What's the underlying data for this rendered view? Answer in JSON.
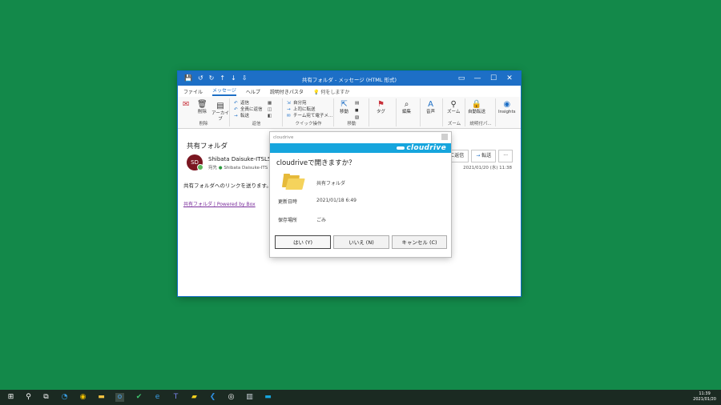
{
  "window": {
    "title": "共有フォルダ - メッセージ (HTML 形式)",
    "quick_access": [
      "💾",
      "↺",
      "↻",
      "↑",
      "↓",
      "⇩"
    ],
    "controls": [
      "▭",
      "—",
      "☐",
      "✕"
    ]
  },
  "tabs": {
    "items": [
      "ファイル",
      "メッセージ",
      "ヘルプ",
      "説明付きパスタ"
    ],
    "tell_me": "何をしますか"
  },
  "ribbon": {
    "delete": {
      "label": "削除",
      "archive": "アーカイブ",
      "group": "削除"
    },
    "respond": {
      "reply": "返信",
      "reply_all": "全員に返信",
      "forward": "転送",
      "group": "返信"
    },
    "quick_steps": {
      "items": [
        "自分宛",
        "上司に転送",
        "チーム宛て電子メ..."
      ],
      "group": "クイック操作"
    },
    "move": {
      "label": "移動",
      "group": "移動"
    },
    "tags": {
      "label": "タグ"
    },
    "edit": {
      "label": "編集"
    },
    "speech": {
      "label": "音声"
    },
    "zoom": {
      "label": "ズーム",
      "group": "ズーム"
    },
    "immersive": {
      "label": "自動転送",
      "group": "説明付パ..."
    },
    "insights": {
      "label": "Insights"
    }
  },
  "message": {
    "subject": "共有フォルダ",
    "avatar_initials": "SD",
    "sender": "Shibata Daisuke-ITSL5",
    "to_label": "宛先",
    "to_value": "Shibata Daisuke-ITS",
    "reply_all": "全員に返信",
    "forward": "転送",
    "more": "···",
    "date": "2021/01/20 (水) 11:38",
    "body": "共有フォルダへのリンクを送ります。",
    "link": "共有フォルダ | Powered by Box"
  },
  "dialog": {
    "window_title": "cloudrive",
    "logo": "cloudrive",
    "question": "cloudriveで開きますか？",
    "item_name": "共有フォルダ",
    "modified_label": "更新日時",
    "modified_value": "2021/01/18 6:49",
    "location_label": "保存場所",
    "location_value": "ごみ",
    "yes": "はい (Y)",
    "no": "いいえ (N)",
    "cancel": "キャンセル (C)"
  },
  "taskbar": {
    "icons": [
      "start-icon",
      "search-icon",
      "task-view-icon",
      "edge-icon",
      "chrome-icon",
      "file-explorer-icon",
      "outlook-icon",
      "check-icon",
      "ie-icon",
      "teams-icon",
      "sticky-notes-icon",
      "vscode-icon",
      "app-icon",
      "app2-icon",
      "cloudrive-icon"
    ],
    "time": "11:39",
    "date": "2021/01/20"
  },
  "colors": {
    "desktop": "#13894a",
    "titlebar": "#1d6fc6",
    "banner": "#16a5dd"
  }
}
